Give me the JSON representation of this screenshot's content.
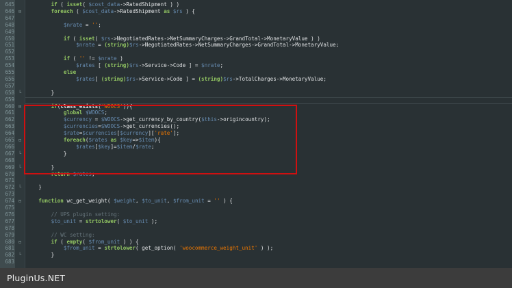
{
  "footer": {
    "brand": "PluginUs.NET"
  },
  "colors": {
    "background": "#293134",
    "keyword": "#93c763",
    "variable": "#678cb1",
    "string": "#ec7600",
    "comment": "#66747b",
    "highlight_box": "#d01010"
  },
  "editor": {
    "lines": [
      {
        "n": "645",
        "fold": "",
        "tokens": [
          [
            "pl",
            "        "
          ],
          [
            "kw",
            "if"
          ],
          [
            "pl",
            " ( "
          ],
          [
            "kw",
            "isset"
          ],
          [
            "pl",
            "( "
          ],
          [
            "var",
            "$cost_data"
          ],
          [
            "pl",
            "->RatedShipment ) )"
          ]
        ]
      },
      {
        "n": "646",
        "fold": "⊟",
        "tokens": [
          [
            "pl",
            "        "
          ],
          [
            "kw",
            "foreach"
          ],
          [
            "pl",
            " ( "
          ],
          [
            "var",
            "$cost_data"
          ],
          [
            "pl",
            "->RatedShipment "
          ],
          [
            "kw",
            "as"
          ],
          [
            "pl",
            " "
          ],
          [
            "var",
            "$rs"
          ],
          [
            "pl",
            " ) {"
          ]
        ]
      },
      {
        "n": "647",
        "fold": "",
        "tokens": []
      },
      {
        "n": "648",
        "fold": "",
        "tokens": [
          [
            "pl",
            "            "
          ],
          [
            "var",
            "$nrate"
          ],
          [
            "pl",
            " = "
          ],
          [
            "str",
            "''"
          ],
          [
            "pl",
            ";"
          ]
        ]
      },
      {
        "n": "649",
        "fold": "",
        "tokens": []
      },
      {
        "n": "650",
        "fold": "",
        "tokens": [
          [
            "pl",
            "            "
          ],
          [
            "kw",
            "if"
          ],
          [
            "pl",
            " ( "
          ],
          [
            "kw",
            "isset"
          ],
          [
            "pl",
            "( "
          ],
          [
            "var",
            "$rs"
          ],
          [
            "pl",
            "->NegotiatedRates->NetSummaryCharges->GrandTotal->MonetaryValue ) )"
          ]
        ]
      },
      {
        "n": "651",
        "fold": "",
        "tokens": [
          [
            "pl",
            "                "
          ],
          [
            "var",
            "$nrate"
          ],
          [
            "pl",
            " = "
          ],
          [
            "kw",
            "(string)"
          ],
          [
            "var",
            "$rs"
          ],
          [
            "pl",
            "->NegotiatedRates->NetSummaryCharges->GrandTotal->MonetaryValue;"
          ]
        ]
      },
      {
        "n": "652",
        "fold": "",
        "tokens": []
      },
      {
        "n": "653",
        "fold": "",
        "tokens": [
          [
            "pl",
            "            "
          ],
          [
            "kw",
            "if"
          ],
          [
            "pl",
            " ( "
          ],
          [
            "str",
            "''"
          ],
          [
            "pl",
            " != "
          ],
          [
            "var",
            "$nrate"
          ],
          [
            "pl",
            " )"
          ]
        ]
      },
      {
        "n": "654",
        "fold": "",
        "tokens": [
          [
            "pl",
            "                "
          ],
          [
            "var",
            "$rates"
          ],
          [
            "pl",
            " [ "
          ],
          [
            "kw",
            "(string)"
          ],
          [
            "var",
            "$rs"
          ],
          [
            "pl",
            "->Service->Code ] = "
          ],
          [
            "var",
            "$nrate"
          ],
          [
            "pl",
            ";"
          ]
        ]
      },
      {
        "n": "655",
        "fold": "",
        "tokens": [
          [
            "pl",
            "            "
          ],
          [
            "kw",
            "else"
          ]
        ]
      },
      {
        "n": "656",
        "fold": "",
        "tokens": [
          [
            "pl",
            "                "
          ],
          [
            "var",
            "$rates"
          ],
          [
            "pl",
            "[ "
          ],
          [
            "kw",
            "(string)"
          ],
          [
            "var",
            "$rs"
          ],
          [
            "pl",
            "->Service->Code ] = "
          ],
          [
            "kw",
            "(string)"
          ],
          [
            "var",
            "$rs"
          ],
          [
            "pl",
            "->TotalCharges->MonetaryValue;"
          ]
        ]
      },
      {
        "n": "657",
        "fold": "",
        "tokens": []
      },
      {
        "n": "658",
        "fold": "└",
        "tokens": [
          [
            "pl",
            "        }"
          ]
        ]
      },
      {
        "n": "659",
        "fold": "",
        "tokens": []
      },
      {
        "n": "660",
        "fold": "⊟",
        "tokens": [
          [
            "pl",
            "        "
          ],
          [
            "kw",
            "if"
          ],
          [
            "pl",
            "("
          ],
          [
            "fn",
            "class_exists"
          ],
          [
            "pl",
            "("
          ],
          [
            "str",
            "'WOOCS'"
          ],
          [
            "pl",
            "))"
          ],
          [
            "pl",
            "{"
          ]
        ]
      },
      {
        "n": "661",
        "fold": "",
        "tokens": [
          [
            "pl",
            "            "
          ],
          [
            "kw",
            "global"
          ],
          [
            "pl",
            " "
          ],
          [
            "var",
            "$WOOCS"
          ],
          [
            "pl",
            ";"
          ]
        ]
      },
      {
        "n": "662",
        "fold": "",
        "tokens": [
          [
            "pl",
            "            "
          ],
          [
            "var",
            "$currency"
          ],
          [
            "pl",
            " = "
          ],
          [
            "var",
            "$WOOCS"
          ],
          [
            "pl",
            "->get_currency_by_country("
          ],
          [
            "var",
            "$this"
          ],
          [
            "pl",
            "->origincountry);"
          ]
        ]
      },
      {
        "n": "663",
        "fold": "",
        "tokens": [
          [
            "pl",
            "            "
          ],
          [
            "var",
            "$currencies"
          ],
          [
            "pl",
            "="
          ],
          [
            "var",
            "$WOOCS"
          ],
          [
            "pl",
            "->get_currencies();"
          ]
        ]
      },
      {
        "n": "664",
        "fold": "",
        "tokens": [
          [
            "pl",
            "            "
          ],
          [
            "var",
            "$rate"
          ],
          [
            "pl",
            "="
          ],
          [
            "var",
            "$currencies"
          ],
          [
            "pl",
            "["
          ],
          [
            "var",
            "$currency"
          ],
          [
            "pl",
            "]["
          ],
          [
            "str",
            "'rate'"
          ],
          [
            "pl",
            "];"
          ]
        ]
      },
      {
        "n": "665",
        "fold": "⊟",
        "tokens": [
          [
            "pl",
            "            "
          ],
          [
            "kw",
            "foreach"
          ],
          [
            "pl",
            "("
          ],
          [
            "var",
            "$rates"
          ],
          [
            "pl",
            " "
          ],
          [
            "kw",
            "as"
          ],
          [
            "pl",
            " "
          ],
          [
            "var",
            "$key"
          ],
          [
            "pl",
            "=>"
          ],
          [
            "var",
            "$item"
          ],
          [
            "pl",
            "){"
          ]
        ]
      },
      {
        "n": "666",
        "fold": "",
        "tokens": [
          [
            "pl",
            "                "
          ],
          [
            "var",
            "$rates"
          ],
          [
            "pl",
            "["
          ],
          [
            "var",
            "$key"
          ],
          [
            "pl",
            "]="
          ],
          [
            "var",
            "$item"
          ],
          [
            "pl",
            "/"
          ],
          [
            "var",
            "$rate"
          ],
          [
            "pl",
            ";"
          ]
        ]
      },
      {
        "n": "667",
        "fold": "└",
        "tokens": [
          [
            "pl",
            "            }"
          ]
        ]
      },
      {
        "n": "668",
        "fold": "",
        "tokens": []
      },
      {
        "n": "669",
        "fold": "└",
        "tokens": [
          [
            "pl",
            "        }"
          ]
        ]
      },
      {
        "n": "670",
        "fold": "",
        "tokens": [
          [
            "pl",
            "        "
          ],
          [
            "kw",
            "return"
          ],
          [
            "pl",
            " "
          ],
          [
            "var",
            "$rates"
          ],
          [
            "pl",
            ";"
          ]
        ]
      },
      {
        "n": "671",
        "fold": "",
        "tokens": []
      },
      {
        "n": "672",
        "fold": "└",
        "tokens": [
          [
            "pl",
            "    }"
          ]
        ]
      },
      {
        "n": "673",
        "fold": "",
        "tokens": []
      },
      {
        "n": "674",
        "fold": "⊟",
        "tokens": [
          [
            "pl",
            "    "
          ],
          [
            "kw",
            "function"
          ],
          [
            "pl",
            " wc_get_weight( "
          ],
          [
            "var",
            "$weight"
          ],
          [
            "pl",
            ", "
          ],
          [
            "var",
            "$to_unit"
          ],
          [
            "pl",
            ", "
          ],
          [
            "var",
            "$from_unit"
          ],
          [
            "pl",
            " = "
          ],
          [
            "str",
            "''"
          ],
          [
            "pl",
            " ) {"
          ]
        ]
      },
      {
        "n": "675",
        "fold": "",
        "tokens": []
      },
      {
        "n": "676",
        "fold": "",
        "tokens": [
          [
            "pl",
            "        "
          ],
          [
            "cm",
            "// UPS plugin setting:"
          ]
        ]
      },
      {
        "n": "677",
        "fold": "",
        "tokens": [
          [
            "pl",
            "        "
          ],
          [
            "var",
            "$to_unit"
          ],
          [
            "pl",
            " = "
          ],
          [
            "kw",
            "strtolower"
          ],
          [
            "pl",
            "( "
          ],
          [
            "var",
            "$to_unit"
          ],
          [
            "pl",
            " );"
          ]
        ]
      },
      {
        "n": "678",
        "fold": "",
        "tokens": []
      },
      {
        "n": "679",
        "fold": "",
        "tokens": [
          [
            "pl",
            "        "
          ],
          [
            "cm",
            "// WC setting:"
          ]
        ]
      },
      {
        "n": "680",
        "fold": "⊟",
        "tokens": [
          [
            "pl",
            "        "
          ],
          [
            "kw",
            "if"
          ],
          [
            "pl",
            " ( "
          ],
          [
            "kw",
            "empty"
          ],
          [
            "pl",
            "( "
          ],
          [
            "var",
            "$from_unit"
          ],
          [
            "pl",
            " ) ) {"
          ]
        ]
      },
      {
        "n": "681",
        "fold": "",
        "tokens": [
          [
            "pl",
            "            "
          ],
          [
            "var",
            "$from_unit"
          ],
          [
            "pl",
            " = "
          ],
          [
            "kw",
            "strtolower"
          ],
          [
            "pl",
            "( get_option( "
          ],
          [
            "str",
            "'woocommerce_weight_unit'"
          ],
          [
            "pl",
            " ) );"
          ]
        ]
      },
      {
        "n": "682",
        "fold": "└",
        "tokens": [
          [
            "pl",
            "        }"
          ]
        ]
      },
      {
        "n": "683",
        "fold": "",
        "tokens": []
      }
    ]
  }
}
